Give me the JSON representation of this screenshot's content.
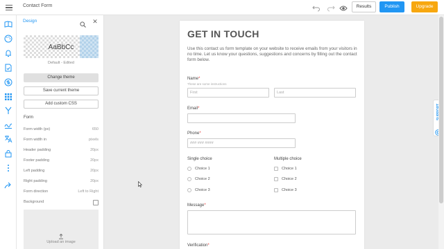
{
  "topbar": {
    "title": "Contact Form",
    "results_label": "Results",
    "publish_label": "Publish",
    "upgrade_label": "Upgrade"
  },
  "colors": {
    "accent": "#2196f3",
    "upgrade": "#f7a70f",
    "required": "#e53935"
  },
  "rail": {
    "icons": [
      "book-icon",
      "palette-icon",
      "bell-icon",
      "document-check-icon",
      "dollar-icon",
      "grid-icon",
      "branch-icon",
      "signature-icon",
      "translate-icon",
      "lock-icon",
      "more-vertical-icon",
      "share-icon"
    ]
  },
  "panel": {
    "title": "Design",
    "theme_sample": "AaBbCc",
    "theme_name": "Default - Edited",
    "change_theme_label": "Change theme",
    "save_theme_label": "Save current theme",
    "custom_css_label": "Add custom CSS",
    "section_form": "Form",
    "settings": [
      {
        "label": "Form width (px)",
        "value": "650"
      },
      {
        "label": "Form width in",
        "value": "pixels"
      },
      {
        "label": "Header padding",
        "value": "20px"
      },
      {
        "label": "Footer padding",
        "value": "20px"
      },
      {
        "label": "Left padding",
        "value": "20px"
      },
      {
        "label": "Right padding",
        "value": "20px"
      },
      {
        "label": "Form direction",
        "value": "Left to Right"
      }
    ],
    "background_label": "Background",
    "upload_label": "Upload an image"
  },
  "form": {
    "heading": "GET IN TOUCH",
    "description": "Use this contact us form template on your website to receive emails from your visitors in no time. Let us know your questions, suggestions and concerns by filling out the contact form below.",
    "name_label": "Name",
    "name_help": "These are some instructions",
    "first_placeholder": "First",
    "last_placeholder": "Last",
    "email_label": "Email",
    "phone_label": "Phone",
    "phone_placeholder": "### ### ####",
    "single_choice_label": "Single choice",
    "multiple_choice_label": "Multiple choice",
    "single_choices": [
      "Choice 1",
      "Choice 2",
      "Choice 3"
    ],
    "multiple_choices": [
      "Choice 1",
      "Choice 2",
      "Choice 3"
    ],
    "message_label": "Message",
    "verification_label": "Verification",
    "required_mark": "*"
  },
  "support": {
    "label": "SUPPORT"
  }
}
